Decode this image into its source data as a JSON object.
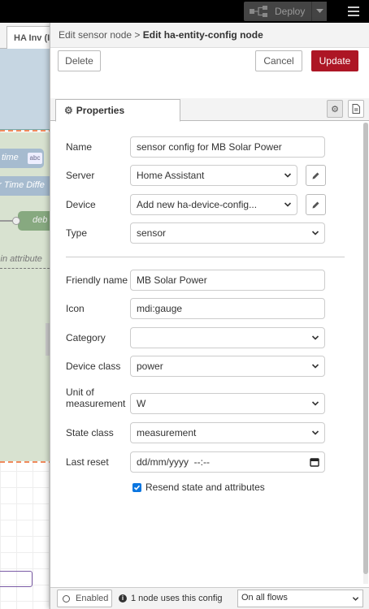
{
  "topbar": {
    "deploy_label": "Deploy"
  },
  "workspace": {
    "tab_label": "HA Inv (I",
    "nodes": {
      "time_label": "time",
      "time_badge": "abc",
      "diff_label": "er Time Diffe",
      "debug_label": "deb",
      "attr_label": "s in attribute"
    }
  },
  "tray": {
    "breadcrumb_parent": "Edit sensor node",
    "breadcrumb_sep": ">",
    "breadcrumb_current": "Edit ha-entity-config node",
    "delete_label": "Delete",
    "cancel_label": "Cancel",
    "update_label": "Update",
    "properties_tab": "Properties"
  },
  "form": {
    "name": {
      "label": "Name",
      "value": "sensor config for MB Solar Power"
    },
    "server": {
      "label": "Server",
      "value": "Home Assistant"
    },
    "device": {
      "label": "Device",
      "value": "Add new ha-device-config..."
    },
    "type": {
      "label": "Type",
      "value": "sensor"
    },
    "friendly_name": {
      "label": "Friendly name",
      "value": "MB Solar Power"
    },
    "icon": {
      "label": "Icon",
      "value": "mdi:gauge"
    },
    "category": {
      "label": "Category",
      "value": ""
    },
    "device_class": {
      "label": "Device class",
      "value": "power"
    },
    "unit": {
      "label": "Unit of measurement",
      "label_line1": "Unit of",
      "label_line2": "measurement",
      "value": "W"
    },
    "state_class": {
      "label": "State class",
      "value": "measurement"
    },
    "last_reset": {
      "label": "Last reset",
      "value": "dd/mm/yyyy  --:--"
    },
    "resend": {
      "label": "Resend state and attributes",
      "checked": true
    }
  },
  "footer": {
    "enabled_label": "Enabled",
    "usage_text": "1 node uses this config",
    "scope_value": "On all flows"
  },
  "colors": {
    "update_button": "#ad1625",
    "checkbox": "#0b76e0",
    "topbar": "#000000"
  },
  "icons": [
    "deploy-icon",
    "caret-down-icon",
    "menu-icon",
    "cog-icon",
    "document-icon",
    "pencil-icon",
    "calendar-icon",
    "check-icon",
    "info-icon",
    "circle-icon"
  ]
}
